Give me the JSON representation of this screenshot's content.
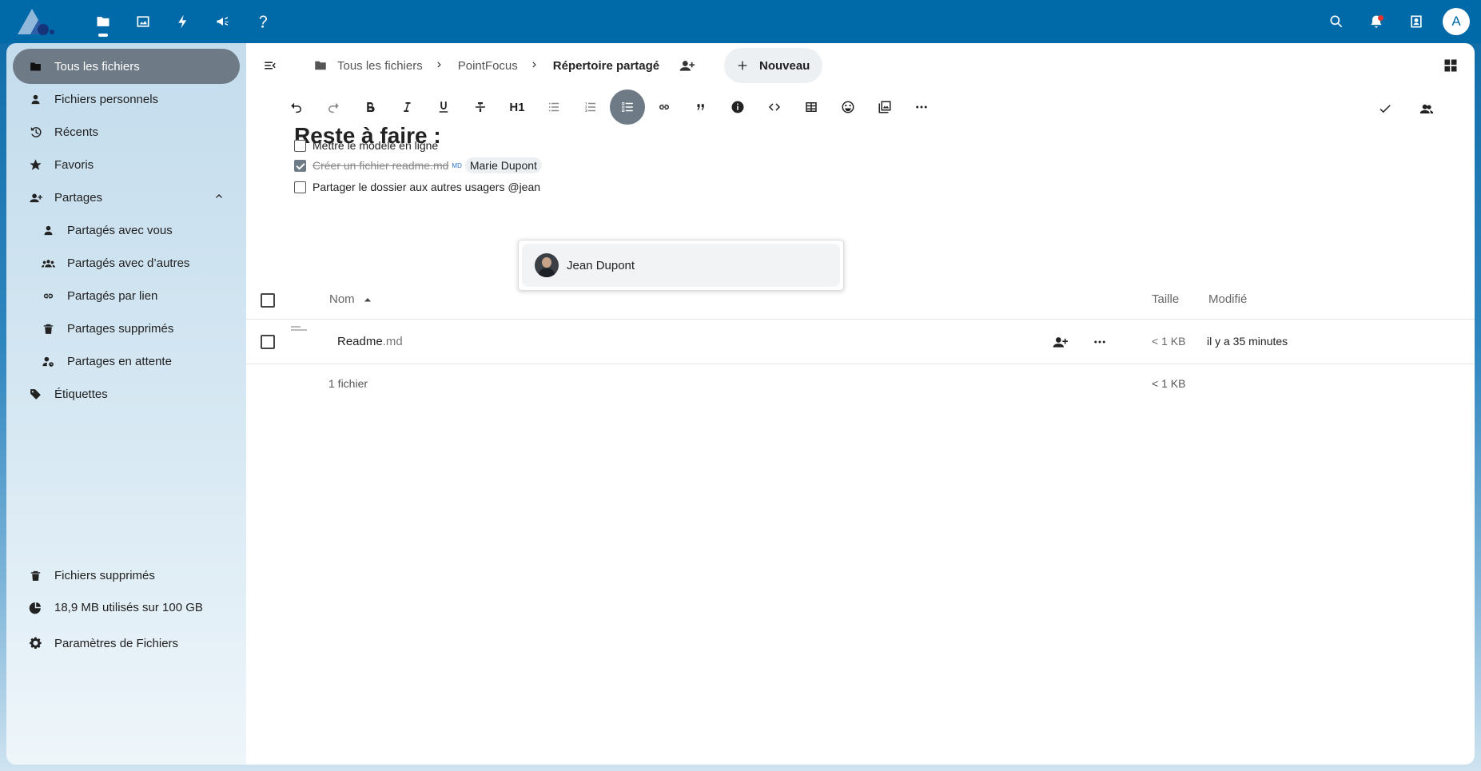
{
  "colors": {
    "header": "#0069a8",
    "active_nav": "#6e7b86",
    "accent": "#2a72c9"
  },
  "topbar": {
    "apps": [
      {
        "name": "files",
        "icon": "folder-icon"
      },
      {
        "name": "photos",
        "icon": "image-icon"
      },
      {
        "name": "activity",
        "icon": "bolt-icon"
      },
      {
        "name": "announcements",
        "icon": "megaphone-icon"
      },
      {
        "name": "help",
        "icon": "question-icon"
      }
    ],
    "avatar_initial": "A"
  },
  "sidebar": {
    "items": [
      {
        "label": "Tous les fichiers",
        "icon": "folder-icon"
      },
      {
        "label": "Fichiers personnels",
        "icon": "user-icon"
      },
      {
        "label": "Récents",
        "icon": "history-icon"
      },
      {
        "label": "Favoris",
        "icon": "star-icon"
      },
      {
        "label": "Partages",
        "icon": "share-icon"
      },
      {
        "label": "Partagés avec vous",
        "icon": "user-icon"
      },
      {
        "label": "Partagés avec d’autres",
        "icon": "group-icon"
      },
      {
        "label": "Partagés par lien",
        "icon": "link-icon"
      },
      {
        "label": "Partages supprimés",
        "icon": "trash-icon"
      },
      {
        "label": "Partages en attente",
        "icon": "user-clock-icon"
      },
      {
        "label": "Étiquettes",
        "icon": "tag-icon"
      }
    ],
    "footer": {
      "deleted": "Fichiers supprimés",
      "quota": "18,9 MB utilisés sur 100 GB",
      "settings": "Paramètres de Fichiers"
    }
  },
  "breadcrumb": {
    "items": [
      "Tous les fichiers",
      "PointFocus"
    ],
    "current": "Répertoire partagé",
    "new_label": "Nouveau"
  },
  "editor": {
    "toolbar_h1": "H1",
    "title": "Reste à faire :",
    "tasks": [
      {
        "text": "Mettre le modèle en ligne",
        "checked": false
      },
      {
        "text": "Créer un fichier readme.md",
        "checked": true,
        "badge": "MD",
        "mention": "Marie Dupont"
      },
      {
        "text": "Partager le dossier aux autres usagers @jean",
        "checked": false
      }
    ],
    "suggestion": "Jean Dupont"
  },
  "table": {
    "col_name": "Nom",
    "col_size": "Taille",
    "col_modified": "Modifié",
    "rows": [
      {
        "name": "Readme",
        "ext": ".md",
        "size": "< 1 KB",
        "modified": "il y a 35 minutes"
      }
    ],
    "summary": "1 fichier",
    "summary_size": "< 1 KB"
  }
}
